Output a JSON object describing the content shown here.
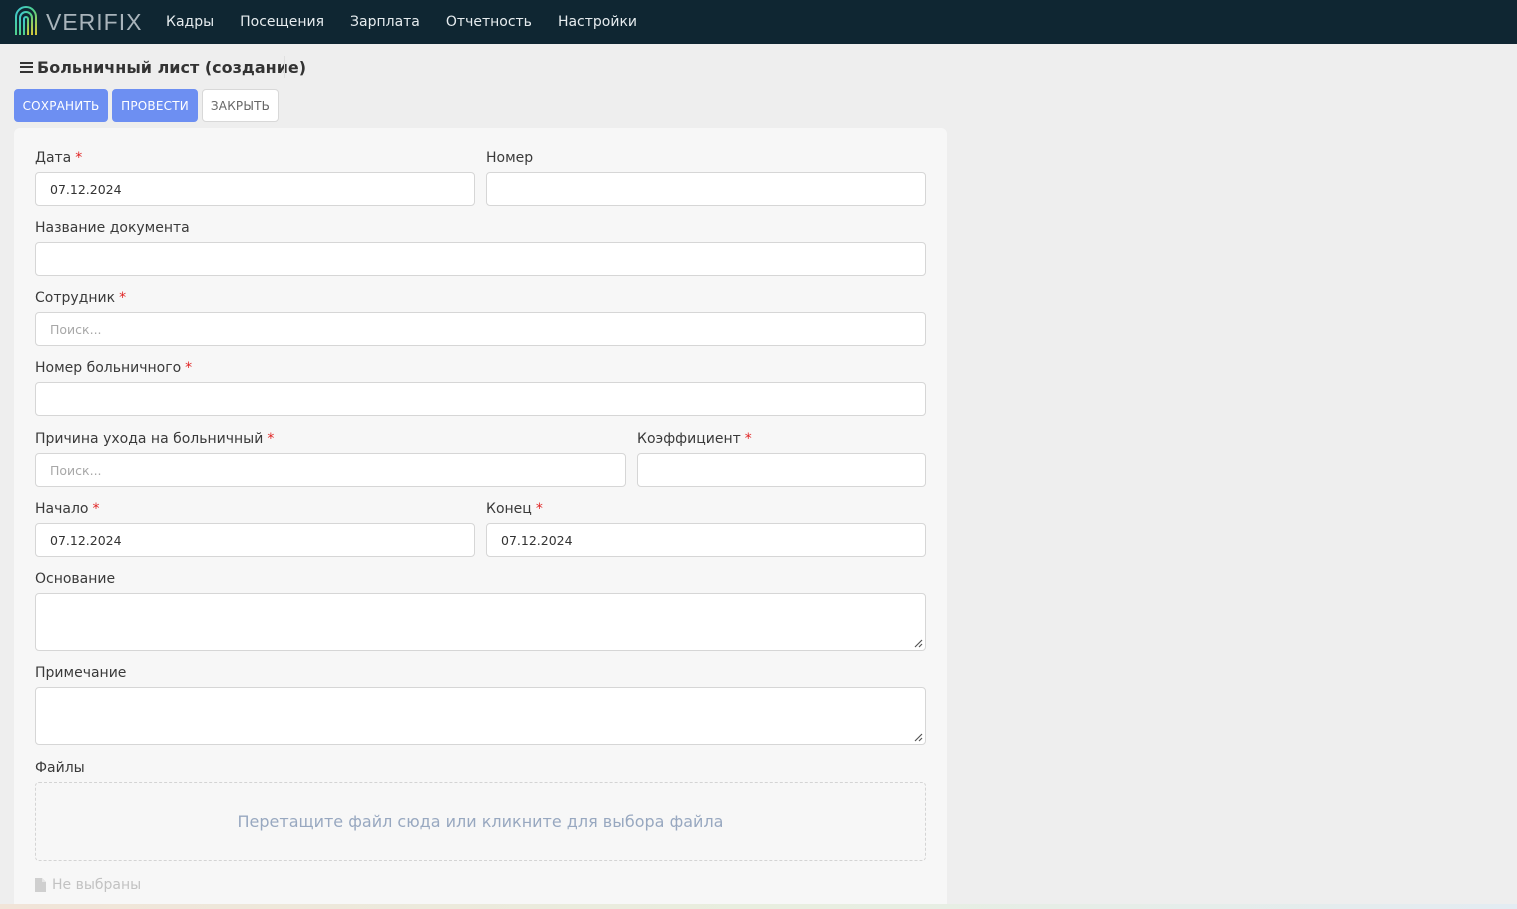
{
  "brand": {
    "name": "VERIFIX"
  },
  "nav": [
    "Кадры",
    "Посещения",
    "Зарплата",
    "Отчетность",
    "Настройки"
  ],
  "page": {
    "title": "Больничный лист (создание)"
  },
  "actions": {
    "save": "СОХРАНИТЬ",
    "post": "ПРОВЕСТИ",
    "close": "ЗАКРЫТЬ"
  },
  "form": {
    "date": {
      "label": "Дата",
      "value": "07.12.2024"
    },
    "number": {
      "label": "Номер",
      "value": ""
    },
    "doc_name": {
      "label": "Название документа",
      "value": ""
    },
    "employee": {
      "label": "Сотрудник",
      "placeholder": "Поиск..."
    },
    "sick_number": {
      "label": "Номер больничного",
      "value": ""
    },
    "reason": {
      "label": "Причина ухода на больничный",
      "placeholder": "Поиск..."
    },
    "coefficient": {
      "label": "Коэффициент",
      "value": ""
    },
    "start": {
      "label": "Начало",
      "value": "07.12.2024"
    },
    "end": {
      "label": "Конец",
      "value": "07.12.2024"
    },
    "basis": {
      "label": "Основание",
      "value": ""
    },
    "note": {
      "label": "Примечание",
      "value": ""
    },
    "files": {
      "label": "Файлы",
      "dropzone_text": "Перетащите файл сюда или кликните для выбора файла",
      "status": "Не выбраны"
    }
  },
  "required_mark": "*",
  "colors": {
    "topbar": "#0f2632",
    "primary": "#6d8ff2",
    "required": "#e02424"
  }
}
